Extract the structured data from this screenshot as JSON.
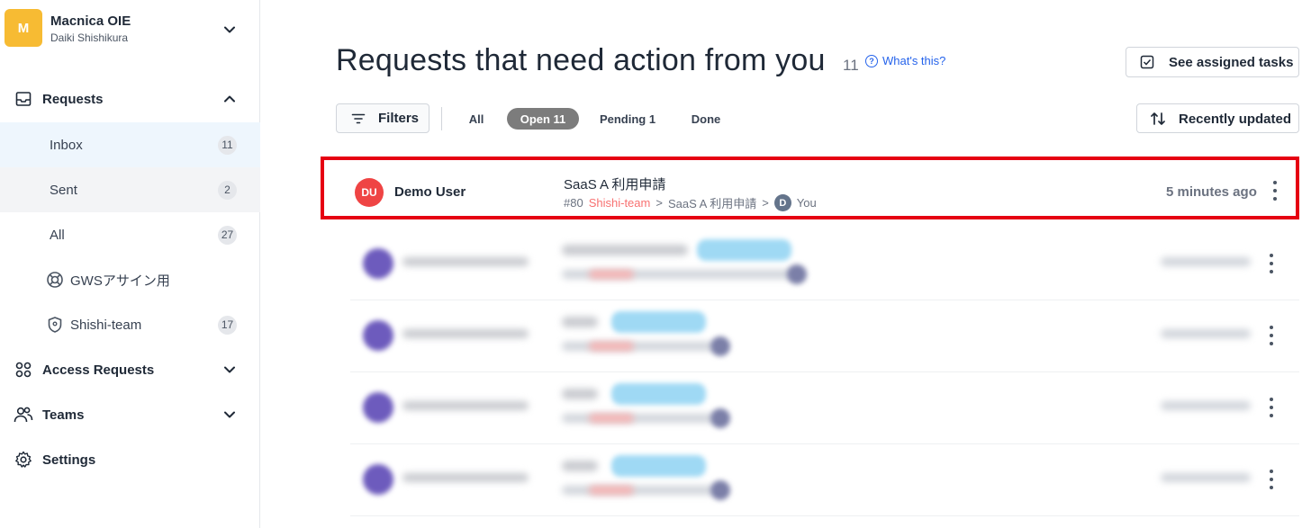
{
  "org": {
    "avatar_letter": "M",
    "name": "Macnica OIE",
    "user": "Daiki Shishikura"
  },
  "sidebar": {
    "requests": {
      "label": "Requests",
      "items": [
        {
          "label": "Inbox",
          "count": "11"
        },
        {
          "label": "Sent",
          "count": "2"
        },
        {
          "label": "All",
          "count": "27"
        },
        {
          "label": "GWSアサイン用",
          "count": ""
        },
        {
          "label": "Shishi-team",
          "count": "17"
        }
      ]
    },
    "access_requests": {
      "label": "Access Requests"
    },
    "teams": {
      "label": "Teams"
    },
    "settings": {
      "label": "Settings"
    }
  },
  "main": {
    "title": "Requests that need action from you",
    "title_count": "11",
    "whats_this": "What's this?",
    "see_assigned_tasks": "See assigned tasks",
    "filters_label": "Filters",
    "tabs": {
      "all": "All",
      "open": "Open 11",
      "pending": "Pending 1",
      "done": "Done"
    },
    "sort_label": "Recently updated"
  },
  "request_row": {
    "avatar_initials": "DU",
    "user_name": "Demo User",
    "title": "SaaS A 利用申請",
    "number": "#80",
    "team": "Shishi-team",
    "sep1": ">",
    "form": "SaaS A 利用申請",
    "sep2": ">",
    "assignee_initial": "D",
    "assignee": "You",
    "time": "5 minutes ago"
  },
  "colors": {
    "org_avatar": "#f7bb33",
    "user_avatar": "#ef4444",
    "highlight_border": "#e60012",
    "active_tab": "#7c7c7c",
    "link": "#2563eb"
  }
}
